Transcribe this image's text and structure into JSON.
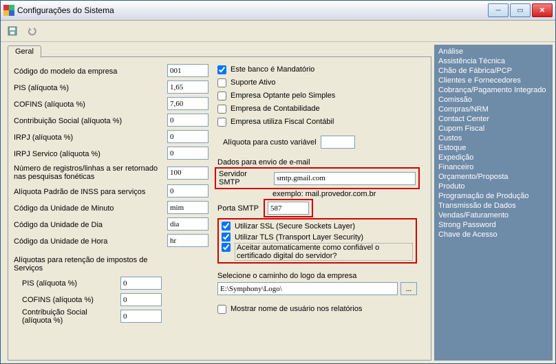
{
  "window": {
    "title": "Configurações do Sistema"
  },
  "tabs": {
    "geral": "Geral"
  },
  "labels": {
    "codigo_modelo": "Código do modelo da empresa",
    "pis": "PIS (alíquota %)",
    "cofins": "COFINS (alíquota %)",
    "contrib_social": "Contribuição Social (alíquota %)",
    "irpj": "IRPJ (alíquota %)",
    "irpj_servico": "IRPJ Servico (alíquota %)",
    "num_registros": "Número de registros/linhas a ser retornado nas pesquisas fonéticas",
    "aliq_inss": "Alíquota Padrão de INSS para serviços",
    "cod_minuto": "Código da Unidade de Minuto",
    "cod_dia": "Código da Unidade de Dia",
    "cod_hora": "Código da Unidade de Hora",
    "retencao_head": "Alíquotas para retenção de impostos de Serviços",
    "ret_pis": "PIS (alíquota %)",
    "ret_cofins": "COFINS (alíquota %)",
    "ret_contrib": "Contribuição Social (alíquota %)"
  },
  "values": {
    "codigo_modelo": "001",
    "pis": "1,65",
    "cofins": "7,60",
    "contrib_social": "0",
    "irpj": "0",
    "irpj_servico": "0",
    "num_registros": "100",
    "aliq_inss": "0",
    "cod_minuto": "mim",
    "cod_dia": "dia",
    "cod_hora": "hr",
    "ret_pis": "0",
    "ret_cofins": "0",
    "ret_contrib": "0"
  },
  "checks": {
    "banco_mandatorio": "Este banco  é  Mandatório",
    "suporte_ativo": "Suporte Ativo",
    "optante_simples": "Empresa Optante pelo Simples",
    "contabilidade": "Empresa de Contabilidade",
    "fiscal_contabil": "Empresa utiliza Fiscal Contábil",
    "aliq_custo": "Alíquota para custo variável",
    "dados_email": "Dados para envio de e-mail",
    "servidor_smtp": "Servidor SMTP",
    "exemplo": "exemplo: mail.provedor.com.br",
    "porta_smtp": "Porta SMTP",
    "use_ssl": "Utilizar SSL (Secure Sockets Layer)",
    "use_tls": "Utilizar TLS (Transport Layer Security)",
    "aceitar_cert": "Aceitar automaticamente como confiável o certificado digital do servidor?",
    "sel_logo": "Selecione  o caminho do logo da empresa",
    "mostrar_nome": "Mostrar nome de usuário nos relatórios"
  },
  "email": {
    "smtp": "smtp.gmail.com",
    "porta": "587",
    "aliq_custo_val": ""
  },
  "logo": {
    "path": "E:\\Symphony\\Logo\\",
    "browse": "..."
  },
  "sidebar": {
    "items": [
      "Análise",
      "Assistência Técnica",
      "Chão de Fábrica/PCP",
      "Clientes e Fornecedores",
      "Cobrança/Pagamento Integrado",
      "Comissão",
      "Compras/NRM",
      "Contact Center",
      "Cupom Fiscal",
      "Custos",
      "Estoque",
      "Expedição",
      "Financeiro",
      "Orçamento/Proposta",
      "Produto",
      "Programação de Produção",
      "Transmissão de Dados",
      "Vendas/Faturamento",
      "Strong Password",
      "Chave de Acesso"
    ]
  }
}
